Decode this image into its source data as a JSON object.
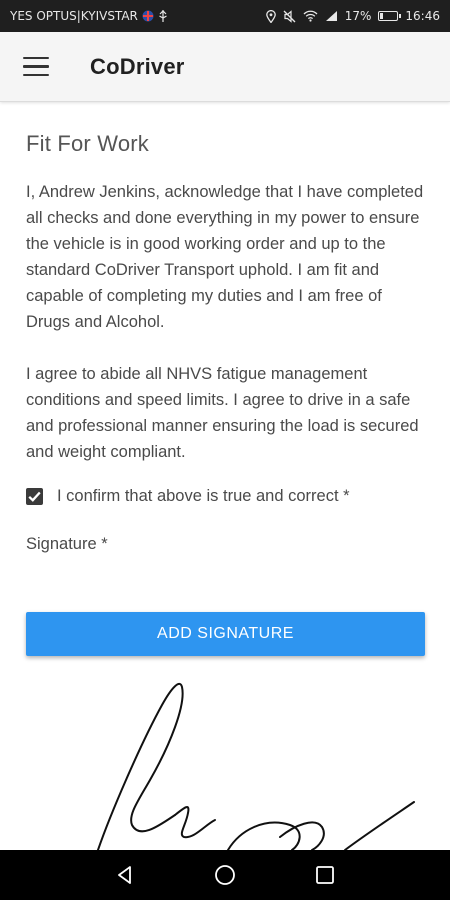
{
  "status_bar": {
    "carrier": "YES OPTUS|KYIVSTAR",
    "battery_percent": "17%",
    "battery_level": 0.17,
    "time": "16:46",
    "icons": [
      "flag-icon",
      "usb-icon",
      "location-icon",
      "mute-icon",
      "wifi-icon",
      "signal-icon",
      "battery-icon"
    ]
  },
  "app_bar": {
    "menu_icon": "hamburger-menu-icon",
    "title": "CoDriver"
  },
  "form": {
    "title": "Fit For Work",
    "paragraph1": "I, Andrew Jenkins, acknowledge that I have completed all checks and done everything in my power to ensure the vehicle is in good working order and up to the standard CoDriver Transport uphold. I am fit and capable of completing my duties and I am free of Drugs and Alcohol.",
    "paragraph2": "I agree to abide all NHVS fatigue management conditions and speed limits. I agree to drive in a safe and professional manner ensuring the load is secured and weight compliant.",
    "confirm_checked": true,
    "confirm_label": "I confirm that above is true and correct *",
    "signature_label": "Signature *",
    "add_signature_button": "ADD SIGNATURE"
  },
  "nav_bar": {
    "icons": [
      "back-icon",
      "home-icon",
      "recents-icon"
    ]
  },
  "colors": {
    "status_bar": "#1f1f1f",
    "app_bar": "#f5f5f5",
    "button": "#2e95f0",
    "nav_bar": "#000000"
  }
}
